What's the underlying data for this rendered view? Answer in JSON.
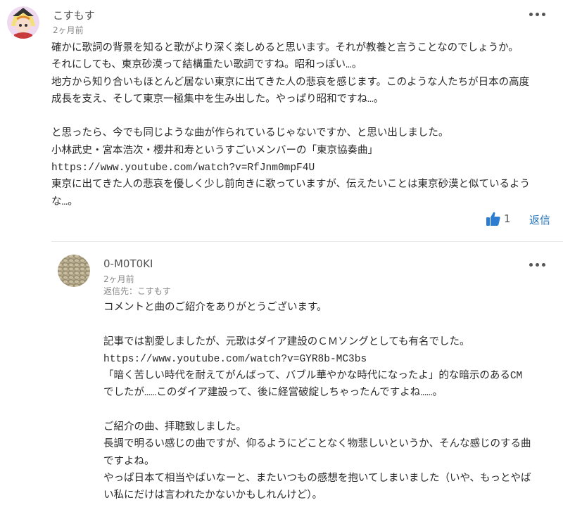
{
  "comments": [
    {
      "author": "こすもす",
      "time": "2ヶ月前",
      "body": "確かに歌詞の背景を知ると歌がより深く楽しめると思います。それが教養と言うことなのでしょうか。\nそれにしても、東京砂漠って結構重たい歌詞ですね。昭和っぽい…。\n地方から知り合いもほとんど居ない東京に出てきた人の悲哀を感じます。このような人たちが日本の高度\n成長を支え、そして東京一極集中を生み出した。やっぱり昭和ですね…。\n\nと思ったら、今でも同じような曲が作られているじゃないですか、と思い出しました。\n小林武史・宮本浩次・櫻井和寿というすごいメンバーの「東京協奏曲」\nhttps://www.youtube.com/watch?v=RfJnm0mpF4U\n東京に出てきた人の悲哀を優しく少し前向きに歌っていますが、伝えたいことは東京砂漠と似ているよう\nな…。",
      "like_count": "1",
      "reply_label": "返信"
    }
  ],
  "reply": {
    "author": "0-M0T0KI",
    "time": "2ヶ月前",
    "reply_to": "返信先：こすもす",
    "body": "コメントと曲のご紹介をありがとうございます。\n\n記事では割愛しましたが、元歌はダイア建設のＣＭソングとしても有名でした。\nhttps://www.youtube.com/watch?v=GYR8b-MC3bs\n「暗く苦しい時代を耐えてがんばって、バブル華やかな時代になったよ」的な暗示のあるCM\nでしたが……このダイア建設って、後に経営破綻しちゃったんですよね……。\n\nご紹介の曲、拝聴致しました。\n長調で明るい感じの曲ですが、仰るようにどことなく物悲しいというか、そんな感じのする曲\nですよね。\nやっぱ日本て相当やばいなーと、またいつもの感想を抱いてしまいました（いや、もっとやば\nい私にだけは言われたかないかもしれんけど）。"
  },
  "colors": {
    "link_blue": "#1e6fb8",
    "like_blue": "#2c7dd1",
    "meta_gray": "#888888"
  },
  "icons": {
    "more": "more-options-icon",
    "like": "thumbs-up-icon"
  }
}
